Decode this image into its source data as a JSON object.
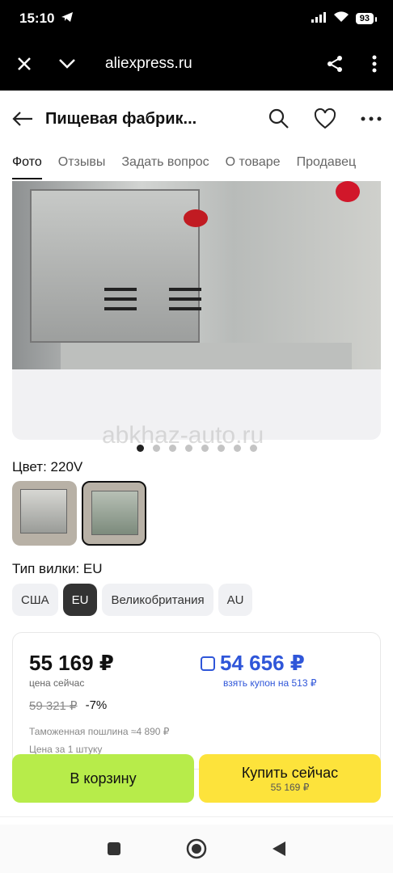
{
  "status": {
    "time": "15:10",
    "battery": "93"
  },
  "browser": {
    "url": "aliexpress.ru"
  },
  "appbar": {
    "title": "Пищевая фабрик..."
  },
  "tabs": [
    "Фото",
    "Отзывы",
    "Задать вопрос",
    "О товаре",
    "Продавец"
  ],
  "watermark": "abkhaz-auto.ru",
  "gallery": {
    "dots_total": 8,
    "active_index": 0
  },
  "color": {
    "label": "Цвет: 220V"
  },
  "plug": {
    "label": "Тип вилки: EU",
    "options": [
      "США",
      "EU",
      "Великобритания",
      "AU"
    ],
    "selected": "EU"
  },
  "price": {
    "current": "55 169 ₽",
    "current_sub": "цена сейчас",
    "old": "59 321 ₽",
    "discount": "-7%",
    "coupon_price": "54 656 ₽",
    "coupon_sub": "взять купон на 513 ₽",
    "duty": "Таможенная пошлина ≈4 890 ₽",
    "per_unit": "Цена за 1 штуку"
  },
  "actions": {
    "cart": "В корзину",
    "buy": "Купить сейчас",
    "buy_sub": "55 169 ₽"
  },
  "colors": {
    "cart": "#b7ec4a",
    "buy": "#fde33b",
    "coupon": "#2f56d9"
  }
}
